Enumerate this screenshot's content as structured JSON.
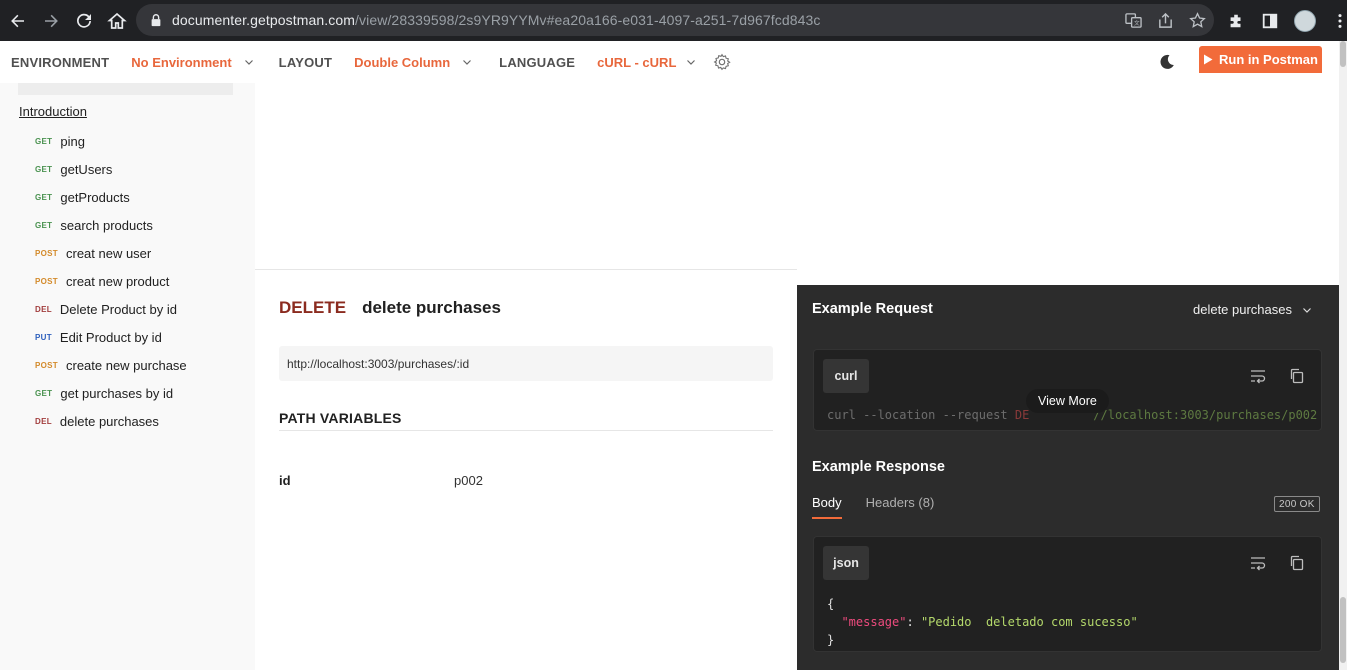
{
  "browser": {
    "url_host": "documenter.getpostman.com",
    "url_path": "/view/28339598/2s9YR9YYMv#ea20a166-e031-4097-a251-7d967fcd843c",
    "icons": [
      "back-icon",
      "forward-icon",
      "reload-icon",
      "home-icon",
      "lock-icon",
      "translate-icon",
      "share-icon",
      "star-icon",
      "extensions-icon",
      "sidepanel-icon",
      "avatar"
    ]
  },
  "topbar": {
    "environment_label": "ENVIRONMENT",
    "environment_value": "No Environment",
    "layout_label": "LAYOUT",
    "layout_value": "Double Column",
    "language_label": "LANGUAGE",
    "language_value": "cURL - cURL",
    "run_button": "Run in Postman",
    "accent_color": "#f26b3a"
  },
  "sidebar": {
    "intro": "Introduction",
    "items": [
      {
        "method": "GET",
        "name": "ping"
      },
      {
        "method": "GET",
        "name": "getUsers"
      },
      {
        "method": "GET",
        "name": "getProducts"
      },
      {
        "method": "GET",
        "name": "search products"
      },
      {
        "method": "POST",
        "name": "creat new user"
      },
      {
        "method": "POST",
        "name": "creat new product"
      },
      {
        "method": "DEL",
        "name": "Delete Product by id"
      },
      {
        "method": "PUT",
        "name": "Edit Product by id"
      },
      {
        "method": "POST",
        "name": "create new purchase"
      },
      {
        "method": "GET",
        "name": "get purchases by id"
      },
      {
        "method": "DEL",
        "name": "delete purchases"
      }
    ]
  },
  "request": {
    "method": "DELETE",
    "name": "delete purchases",
    "url": "http://localhost:3003/purchases/:id",
    "path_variables_title": "PATH VARIABLES",
    "path_variables": [
      {
        "key": "id",
        "value": "p002"
      }
    ]
  },
  "example_request": {
    "title": "Example Request",
    "selected": "delete purchases",
    "lang": "curl",
    "code_cmd": "curl --location --request ",
    "code_method": "DE",
    "code_url": "//localhost:3003/purchases/p002",
    "view_more": "View More"
  },
  "example_response": {
    "title": "Example Response",
    "tab_body": "Body",
    "tab_headers": "Headers (8)",
    "status": "200 OK",
    "lang": "json",
    "open_brace": "{",
    "key": "\"message\"",
    "colon": ": ",
    "value": "\"Pedido  deletado com sucesso\"",
    "close_brace": "}"
  }
}
